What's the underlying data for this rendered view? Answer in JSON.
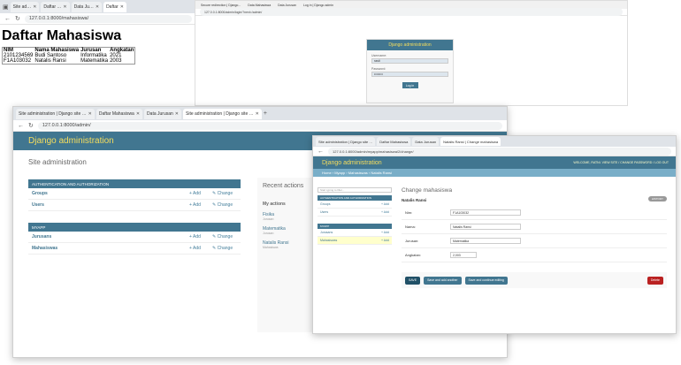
{
  "w1": {
    "tabs": [
      "Site ad…",
      "Daftar …",
      "Data Ju…",
      "Daftar"
    ],
    "url": "127.0.0.1:8000/mahasiswa/",
    "title": "Daftar Mahasiswa",
    "headers": [
      "NIM",
      "Nama Mahasiswa",
      "Jurusan",
      "Angkatan"
    ],
    "rows": [
      [
        "2101234569",
        "Budi Santoso",
        "Informatika",
        "2021"
      ],
      [
        "F1A103032",
        "Natalis Ransi",
        "Matematika",
        "2003"
      ]
    ]
  },
  "w2": {
    "tabs": [
      "Secure redirection | Django...",
      "Data Mahasiswa",
      "Data Jurusan",
      "Log in | Django admin"
    ],
    "url": "127.0.0.1:8000/admin/login/?next=/admin/",
    "header": "Django administration",
    "user_label": "Username:",
    "user_value": "rasti",
    "pass_label": "Password:",
    "pass_value": "••••••••",
    "button": "Log in"
  },
  "w3": {
    "tabs": [
      "Site administration | Django site …",
      "Daftar Mahasiswa",
      "Data Jurusan",
      "Site administration | Django site …"
    ],
    "url": "127.0.0.1:8000/admin/",
    "header": "Django administration",
    "site_title": "Site administration",
    "auth_caption": "AUTHENTICATION AND AUTHORIZATION",
    "auth_rows": [
      "Groups",
      "Users"
    ],
    "app_caption": "MYAPP",
    "app_rows": [
      "Jurusans",
      "Mahasiswas"
    ],
    "add": "+ Add",
    "change": "✎ Change",
    "recent_title": "Recent actions",
    "my_actions": "My actions",
    "recent_items": [
      {
        "name": "Fisika",
        "type": "Jurusan"
      },
      {
        "name": "Matematika",
        "type": "Jurusan"
      },
      {
        "name": "Natalis Ransi",
        "type": "Mahasiswa"
      }
    ]
  },
  "w4": {
    "tabs": [
      "Site administration | Django site …",
      "Daftar Mahasiswa",
      "Data Jurusan",
      "Natalis Ransi | Change mahasiswa"
    ],
    "url": "127.0.0.1:8000/admin/myapp/mahasiswa/2/change/",
    "header": "Django administration",
    "tools": "WELCOME, RATNI. VIEW SITE / CHANGE PASSWORD / LOG OUT",
    "breadcrumb": "Home › Myapp › Mahasiswas › Natalis Ransi",
    "filter": "Start typing to filter...",
    "auth_caption": "AUTHENTICATION AND AUTHORIZATION",
    "auth_rows": [
      "Groups",
      "Users"
    ],
    "app_caption": "MYAPP",
    "app_rows": [
      "Jurusans",
      "Mahasiswas"
    ],
    "add": "+ Add",
    "page_title": "Change mahasiswa",
    "object": "Natalis Ransi",
    "history": "HISTORY",
    "fields": [
      {
        "label": "Nim:",
        "value": "F1A103032"
      },
      {
        "label": "Nama:",
        "value": "Natalis Ransi"
      },
      {
        "label": "Jurusan:",
        "value": "Matematika"
      },
      {
        "label": "Angkatan:",
        "value": "2,003"
      }
    ],
    "buttons": [
      "SAVE",
      "Save and add another",
      "Save and continue editing"
    ],
    "delete": "Delete"
  }
}
